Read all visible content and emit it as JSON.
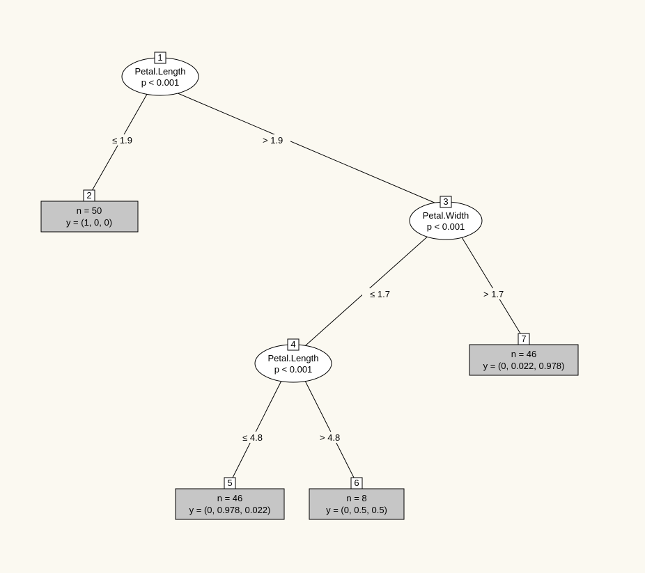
{
  "chart_data": {
    "type": "tree",
    "nodes": {
      "1": {
        "kind": "split",
        "variable": "Petal.Length",
        "p": "p < 0.001"
      },
      "2": {
        "kind": "leaf",
        "n": "n = 50",
        "y": "y = (1, 0, 0)"
      },
      "3": {
        "kind": "split",
        "variable": "Petal.Width",
        "p": "p < 0.001"
      },
      "4": {
        "kind": "split",
        "variable": "Petal.Length",
        "p": "p < 0.001"
      },
      "5": {
        "kind": "leaf",
        "n": "n = 46",
        "y": "y = (0, 0.978, 0.022)"
      },
      "6": {
        "kind": "leaf",
        "n": "n = 8",
        "y": "y = (0, 0.5, 0.5)"
      },
      "7": {
        "kind": "leaf",
        "n": "n = 46",
        "y": "y = (0, 0.022, 0.978)"
      }
    },
    "edges": {
      "e12": {
        "from": "1",
        "to": "2",
        "label": "≤ 1.9"
      },
      "e13": {
        "from": "1",
        "to": "3",
        "label": "> 1.9"
      },
      "e34": {
        "from": "3",
        "to": "4",
        "label": "≤ 1.7"
      },
      "e37": {
        "from": "3",
        "to": "7",
        "label": "> 1.7"
      },
      "e45": {
        "from": "4",
        "to": "5",
        "label": "≤ 4.8"
      },
      "e46": {
        "from": "4",
        "to": "6",
        "label": "> 4.8"
      }
    }
  }
}
